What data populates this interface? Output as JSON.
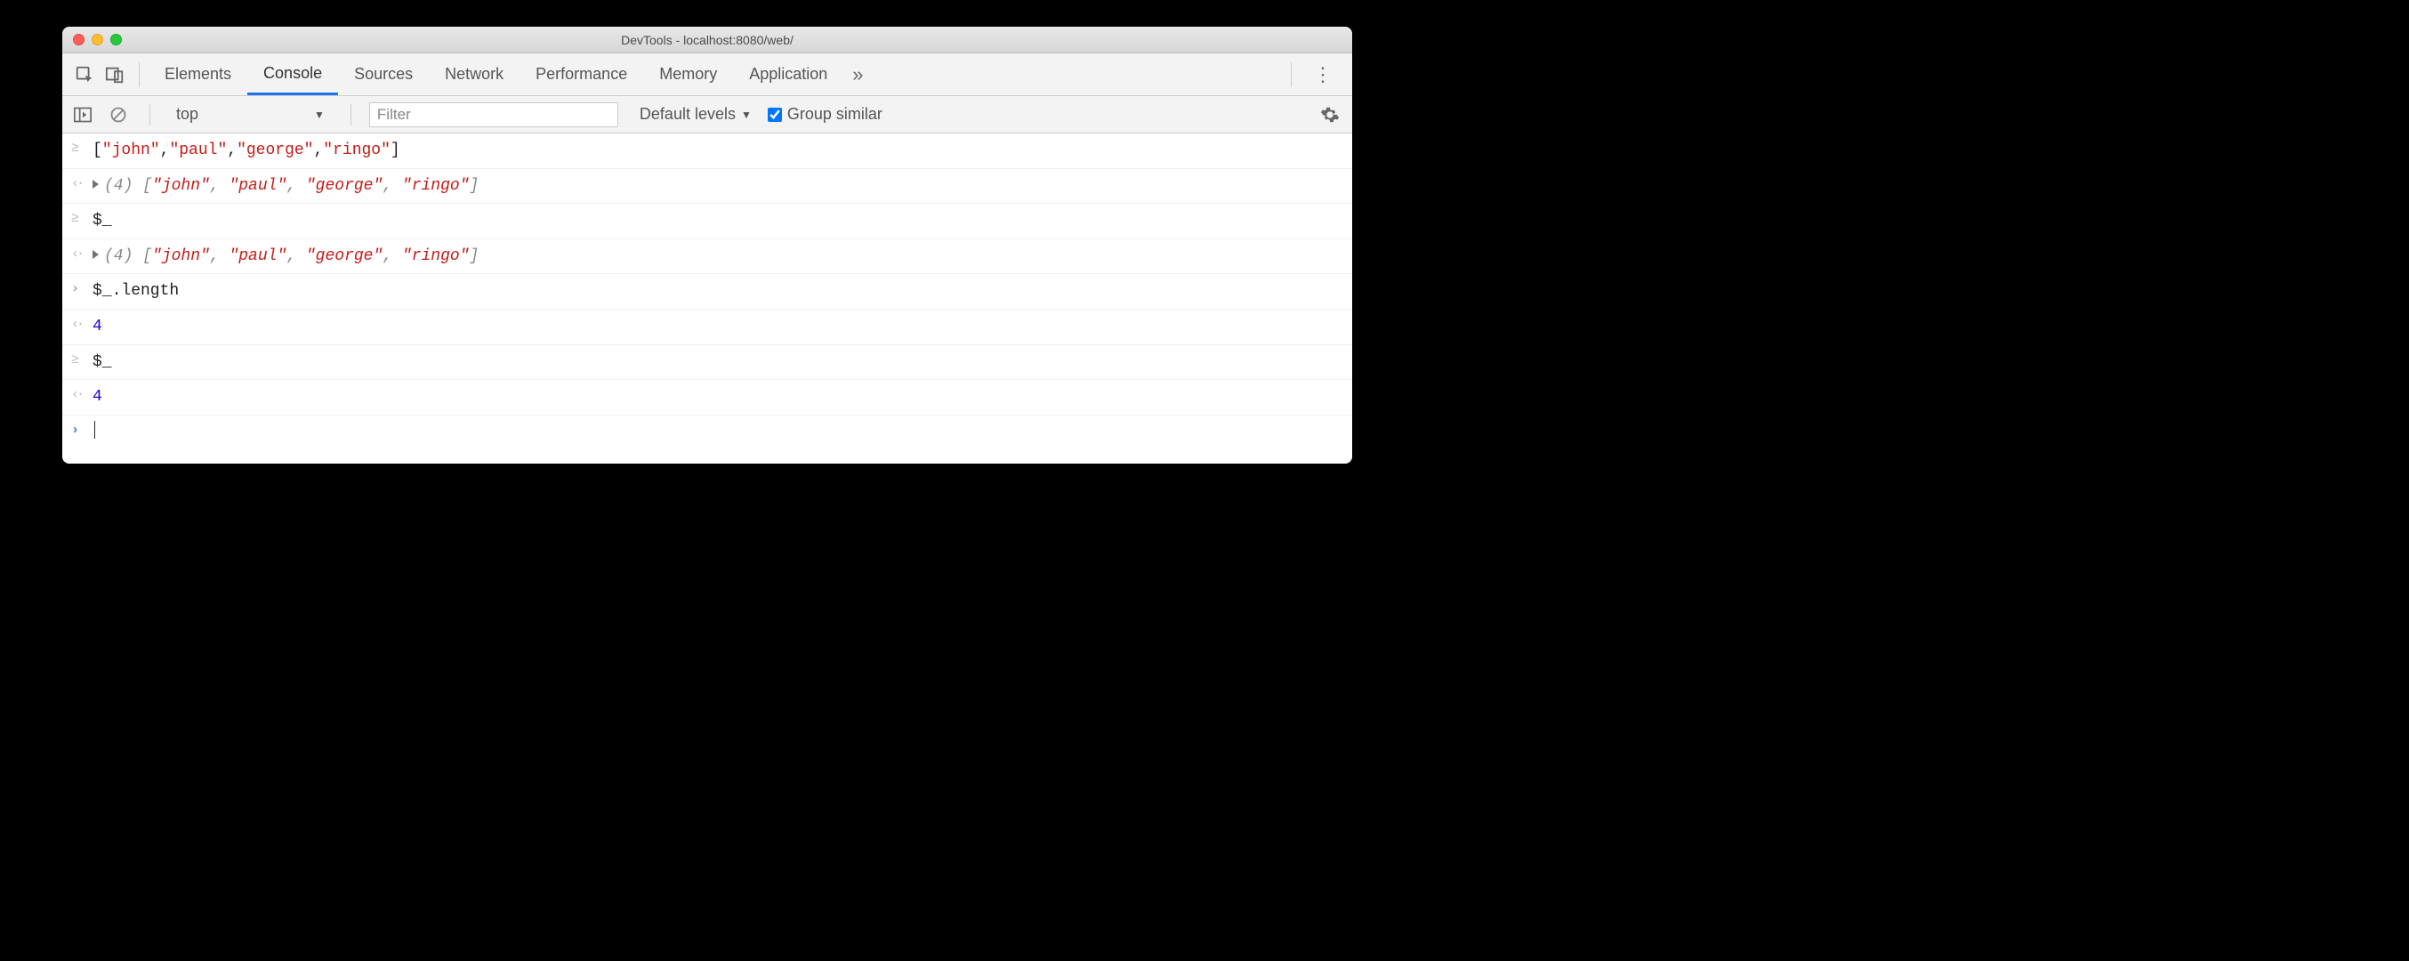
{
  "window": {
    "title": "DevTools - localhost:8080/web/"
  },
  "tabs": {
    "items": [
      "Elements",
      "Console",
      "Sources",
      "Network",
      "Performance",
      "Memory",
      "Application"
    ],
    "active_index": 1
  },
  "toolbar": {
    "context": "top",
    "filter_placeholder": "Filter",
    "levels_label": "Default levels",
    "group_similar_label": "Group similar",
    "group_similar_checked": true
  },
  "console": {
    "entries": [
      {
        "kind": "input-history",
        "tokens": [
          {
            "t": "[",
            "c": "punct-dark"
          },
          {
            "t": "\"john\"",
            "c": "str"
          },
          {
            "t": ",",
            "c": "punct-dark"
          },
          {
            "t": "\"paul\"",
            "c": "str"
          },
          {
            "t": ",",
            "c": "punct-dark"
          },
          {
            "t": "\"george\"",
            "c": "str"
          },
          {
            "t": ",",
            "c": "punct-dark"
          },
          {
            "t": "\"ringo\"",
            "c": "str"
          },
          {
            "t": "]",
            "c": "punct-dark"
          }
        ]
      },
      {
        "kind": "output-array",
        "length_label": "(4) ",
        "tokens": [
          {
            "t": "[",
            "c": "italic"
          },
          {
            "t": "\"john\"",
            "c": "str"
          },
          {
            "t": ", ",
            "c": "italic"
          },
          {
            "t": "\"paul\"",
            "c": "str"
          },
          {
            "t": ", ",
            "c": "italic"
          },
          {
            "t": "\"george\"",
            "c": "str"
          },
          {
            "t": ", ",
            "c": "italic"
          },
          {
            "t": "\"ringo\"",
            "c": "str"
          },
          {
            "t": "]",
            "c": "italic"
          }
        ]
      },
      {
        "kind": "input-history",
        "tokens": [
          {
            "t": "$_",
            "c": "plain"
          }
        ]
      },
      {
        "kind": "output-array",
        "length_label": "(4) ",
        "tokens": [
          {
            "t": "[",
            "c": "italic"
          },
          {
            "t": "\"john\"",
            "c": "str"
          },
          {
            "t": ", ",
            "c": "italic"
          },
          {
            "t": "\"paul\"",
            "c": "str"
          },
          {
            "t": ", ",
            "c": "italic"
          },
          {
            "t": "\"george\"",
            "c": "str"
          },
          {
            "t": ", ",
            "c": "italic"
          },
          {
            "t": "\"ringo\"",
            "c": "str"
          },
          {
            "t": "]",
            "c": "italic"
          }
        ]
      },
      {
        "kind": "input-current",
        "tokens": [
          {
            "t": "$_.length",
            "c": "plain"
          }
        ]
      },
      {
        "kind": "output-number",
        "tokens": [
          {
            "t": "4",
            "c": "num"
          }
        ]
      },
      {
        "kind": "input-history",
        "tokens": [
          {
            "t": "$_",
            "c": "plain"
          }
        ]
      },
      {
        "kind": "output-number",
        "tokens": [
          {
            "t": "4",
            "c": "num"
          }
        ]
      }
    ]
  }
}
